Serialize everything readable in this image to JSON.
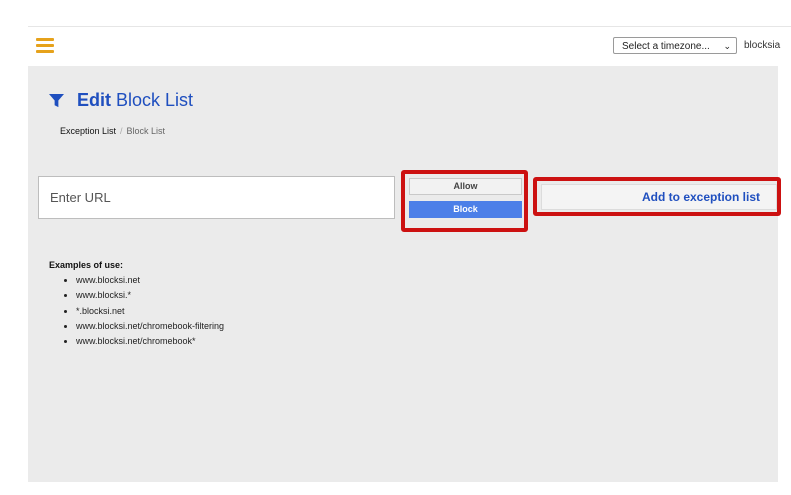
{
  "header": {
    "timezone_select": "Select a timezone...",
    "user_label": "blocksia"
  },
  "page": {
    "title_bold": "Edit",
    "title_rest": "Block List",
    "breadcrumb": [
      "Exception List",
      "Block List"
    ],
    "breadcrumb_separator": "/"
  },
  "form": {
    "url_placeholder": "Enter URL",
    "allow_label": "Allow",
    "block_label": "Block",
    "selected_mode": "Block",
    "add_button_label": "Add to exception list"
  },
  "examples": {
    "title": "Examples of use:",
    "items": [
      "www.blocksi.net",
      "www.blocksi.*",
      "*.blocksi.net",
      "www.blocksi.net/chromebook-filtering",
      "www.blocksi.net/chromebook*"
    ]
  },
  "colors": {
    "accent": "#1f4fbf",
    "menu_icon": "#e6a21b",
    "selected_button": "#4c7fe8",
    "highlight_border": "#cc1111"
  },
  "icons": {
    "menu": "hamburger-icon",
    "title": "filter-icon",
    "select_caret": "chevron-down-icon"
  }
}
